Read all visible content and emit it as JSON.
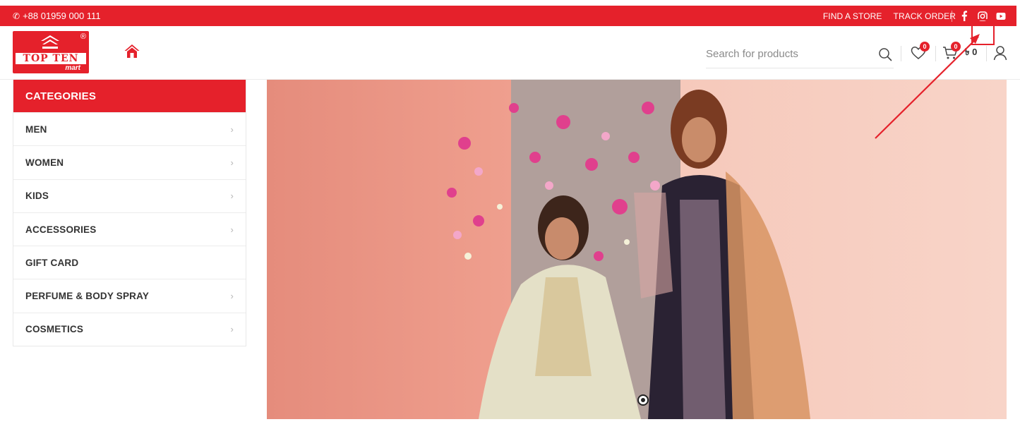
{
  "topbar": {
    "phone": "+88 01959 000 111",
    "links": [
      "FIND A STORE",
      "TRACK ORDER"
    ],
    "social_icons": [
      "facebook-icon",
      "instagram-icon",
      "youtube-icon"
    ]
  },
  "header": {
    "logo": {
      "brand": "TOP TEN",
      "sub": "mart",
      "registered": "®"
    },
    "search_placeholder": "Search for products",
    "wishlist_count": "0",
    "cart_count": "0",
    "cart_total": "৳ 0"
  },
  "categories": {
    "title": "CATEGORIES",
    "items": [
      {
        "label": "MEN",
        "has_sub": true
      },
      {
        "label": "WOMEN",
        "has_sub": true
      },
      {
        "label": "KIDS",
        "has_sub": true
      },
      {
        "label": "ACCESSORIES",
        "has_sub": true
      },
      {
        "label": "GIFT CARD",
        "has_sub": false
      },
      {
        "label": "PERFUME & BODY SPRAY",
        "has_sub": true
      },
      {
        "label": "COSMETICS",
        "has_sub": true
      }
    ]
  },
  "colors": {
    "brand_red": "#e5212b",
    "hero_bg": "#f4c5b8"
  }
}
